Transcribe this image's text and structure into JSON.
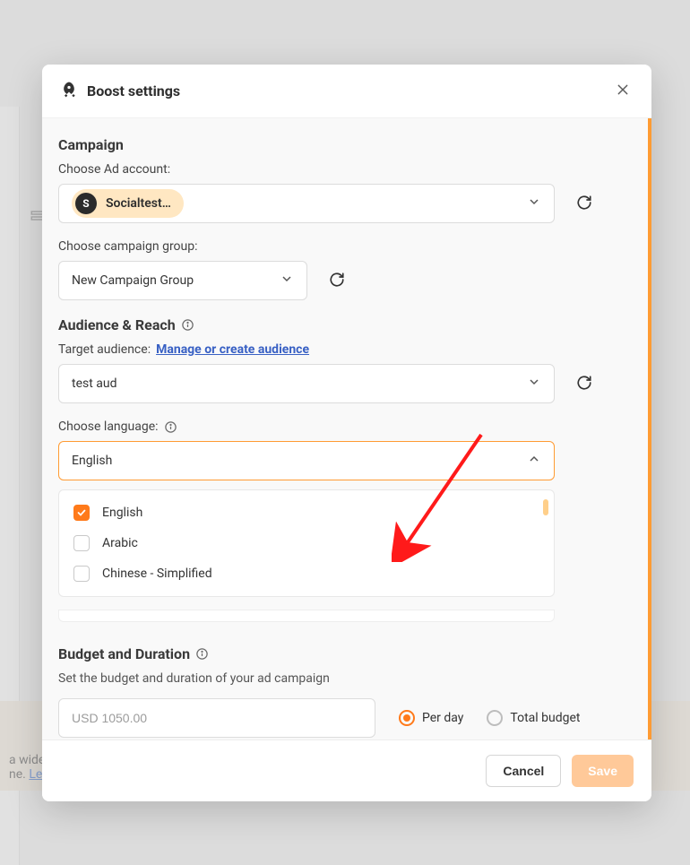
{
  "modal": {
    "title": "Boost settings"
  },
  "campaign": {
    "heading": "Campaign",
    "ad_account_label": "Choose Ad account:",
    "ad_account_chip_letter": "S",
    "ad_account_chip_text": "Socialtest…",
    "group_label": "Choose campaign group:",
    "group_value": "New Campaign Group"
  },
  "audience": {
    "heading": "Audience & Reach",
    "target_label": "Target audience:",
    "manage_link": "Manage or create audience",
    "target_value": "test aud",
    "language_label": "Choose language:",
    "language_value": "English",
    "options": [
      {
        "label": "English",
        "checked": true
      },
      {
        "label": "Arabic",
        "checked": false
      },
      {
        "label": "Chinese - Simplified",
        "checked": false
      }
    ]
  },
  "budget": {
    "heading": "Budget and Duration",
    "desc": "Set the budget and duration of your ad campaign",
    "amount_placeholder": "USD 1050.00",
    "per_day_label": "Per day",
    "total_label": "Total budget",
    "selected": "per_day"
  },
  "footer": {
    "cancel": "Cancel",
    "save": "Save"
  },
  "background": {
    "banner_text": "a wider",
    "banner_text2": "ne.",
    "banner_link": "Lea"
  }
}
